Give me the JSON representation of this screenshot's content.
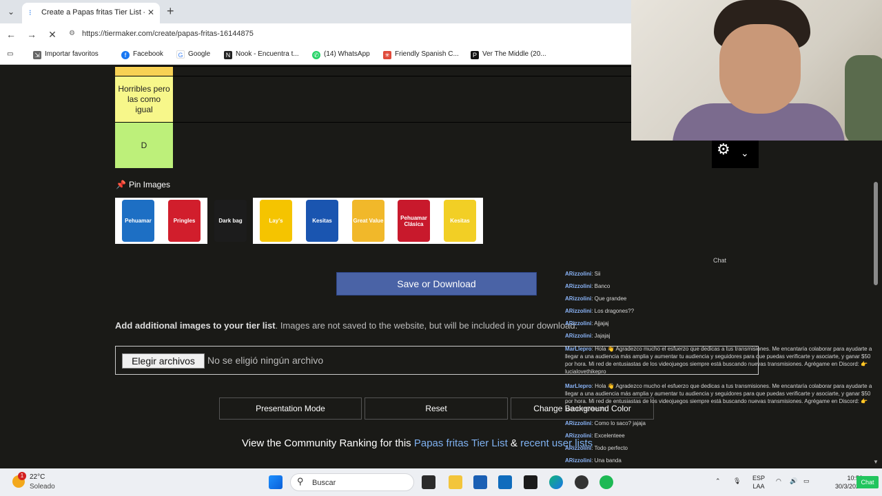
{
  "browser": {
    "tab_title": "Create a Papas fritas Tier List - Tier",
    "url": "https://tiermaker.com/create/papas-fritas-16144875",
    "bookmarks": [
      {
        "label": "Importar favoritos",
        "icon": "import-icon"
      },
      {
        "label": "Facebook",
        "icon": "facebook-icon"
      },
      {
        "label": "Google",
        "icon": "google-icon"
      },
      {
        "label": "Nook - Encuentra t...",
        "icon": "nook-icon"
      },
      {
        "label": "(14) WhatsApp",
        "icon": "whatsapp-icon"
      },
      {
        "label": "Friendly Spanish C...",
        "icon": "friendly-spanish-icon"
      },
      {
        "label": "Ver The Middle (20...",
        "icon": "p-icon"
      }
    ]
  },
  "tiers": [
    {
      "label": "",
      "color": "#f7d154"
    },
    {
      "label": "Horribles pero las como igual",
      "color": "#f7f78a"
    },
    {
      "label": "D",
      "color": "#bdf07a"
    }
  ],
  "pin_label": "Pin Images",
  "pool_images": [
    {
      "name": "Pehuamar",
      "color": "#1d6fc4"
    },
    {
      "name": "Pringles",
      "color": "#d11e2c"
    },
    {
      "name": "Dark bag",
      "color": "#1c1c1c"
    },
    {
      "name": "Lay's",
      "color": "#f5c400"
    },
    {
      "name": "Kesitas",
      "color": "#1a55b0"
    },
    {
      "name": "Great Value",
      "color": "#f1b82a"
    },
    {
      "name": "Pehuamar Clásica",
      "color": "#c8192c"
    },
    {
      "name": "Kesitas",
      "color": "#f2cf25"
    }
  ],
  "save_label": "Save or Download",
  "add_images": {
    "bold": "Add additional images to your tier list",
    "rest": ". Images are not saved to the website, but will be included in your download."
  },
  "file_input": {
    "button": "Elegir archivos",
    "status": "No se eligió ningún archivo"
  },
  "controls": {
    "presentation": "Presentation Mode",
    "reset": "Reset",
    "bg_color": "Change Background Color"
  },
  "community": {
    "prefix": "View the Community Ranking for this ",
    "link1": "Papas fritas Tier List",
    "middle": " & ",
    "link2": "recent user lists"
  },
  "chat": {
    "title": "Chat",
    "messages": [
      {
        "user": "ARizzolini",
        "text": ": Sii"
      },
      {
        "user": "ARizzolini",
        "text": ": Banco"
      },
      {
        "user": "ARizzolini",
        "text": ": Que grandee"
      },
      {
        "user": "ARizzolini",
        "text": ": Los dragones??"
      },
      {
        "user": "ARizzolini",
        "text": ": Ajjajaj"
      },
      {
        "user": "ARizzolini",
        "text": ": Jajajaj"
      },
      {
        "user": "MarLlepro",
        "text": ": Hola 👋 Agradezco mucho el esfuerzo que dedicas a tus transmisiones. Me encantaría colaborar para ayudarte a llegar a una audiencia más amplia y aumentar tu audiencia y seguidores para que puedas verificarte y asociarte, y ganar $50 por hora. Mi red de entusiastas de los videojuegos siempre está buscando nuevas transmisiones. Agrégame en Discord: 👉 lucialovethikepro"
      },
      {
        "user": "MarLlepro",
        "text": ": Hola 👋 Agradezco mucho el esfuerzo que dedicas a tus transmisiones. Me encantaría colaborar para ayudarte a llegar a una audiencia más amplia y aumentar tu audiencia y seguidores para que puedas verificarte y asociarte, y ganar $50 por hora. Mi red de entusiastas de los videojuegos siempre está buscando nuevas transmisiones. Agrégame en Discord: 👉 lucialovethikepro"
      },
      {
        "user": "ARizzolini",
        "text": ": Como lo saco? jajaja"
      },
      {
        "user": "ARizzolini",
        "text": ": Excelenteee"
      },
      {
        "user": "ARizzolini",
        "text": ": Todo perfecto"
      },
      {
        "user": "ARizzolini",
        "text": ": Una banda"
      }
    ]
  },
  "taskbar": {
    "temp": "22°C",
    "condition": "Soleado",
    "badge": "1",
    "search": "Buscar",
    "lang_top": "ESP",
    "lang_bottom": "LAA",
    "time": "10:58",
    "date": "30/3/2026",
    "chat_button": "Chat"
  }
}
